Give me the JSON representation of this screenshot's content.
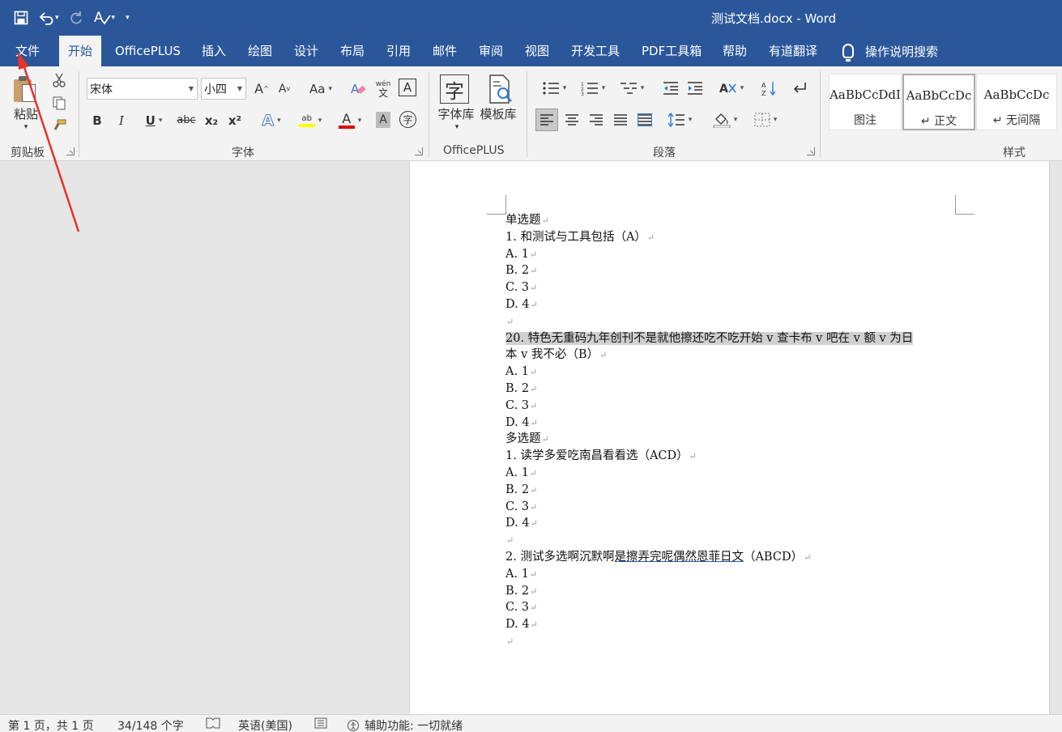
{
  "window": {
    "title": "测试文档.docx  -  Word"
  },
  "qat": {
    "icons": [
      "save-icon",
      "undo-icon",
      "redo-icon",
      "spelling-icon",
      "customize-icon"
    ]
  },
  "tabs": [
    {
      "label": "文件"
    },
    {
      "label": "开始"
    },
    {
      "label": "OfficePLUS"
    },
    {
      "label": "插入"
    },
    {
      "label": "绘图"
    },
    {
      "label": "设计"
    },
    {
      "label": "布局"
    },
    {
      "label": "引用"
    },
    {
      "label": "邮件"
    },
    {
      "label": "审阅"
    },
    {
      "label": "视图"
    },
    {
      "label": "开发工具"
    },
    {
      "label": "PDF工具箱"
    },
    {
      "label": "帮助"
    },
    {
      "label": "有道翻译"
    }
  ],
  "tell_me": "操作说明搜索",
  "ribbon": {
    "clipboard": {
      "paste_label": "粘贴",
      "group_label": "剪贴板"
    },
    "font": {
      "font_name": "宋体",
      "font_size": "小四",
      "group_label": "字体",
      "bold": "B",
      "italic": "I",
      "underline": "U",
      "strike": "abc",
      "subscript": "x₂",
      "superscript": "x²",
      "grow": "A",
      "shrink": "A",
      "case": "Aa",
      "phonetic": "wén",
      "phonetic_sub": "文",
      "border_char": "A",
      "font_color": "A",
      "shade": "A",
      "enclose": "字"
    },
    "officeplus": {
      "font_lib_icon": "字",
      "font_lib_label": "字体库",
      "template_label": "模板库",
      "group_label": "OfficePLUS"
    },
    "paragraph": {
      "group_label": "段落"
    },
    "styles": {
      "group_label": "样式",
      "items": [
        {
          "sample": "AaBbCcDdI",
          "name": "图注"
        },
        {
          "sample": "AaBbCcDc",
          "name": "↵ 正文"
        },
        {
          "sample": "AaBbCcDc",
          "name": "↵ 无间隔"
        }
      ]
    }
  },
  "document": {
    "lines": [
      {
        "text": "单选题",
        "mark": "↵"
      },
      {
        "text": "1. 和测试与工具包括（A）",
        "mark": "↵"
      },
      {
        "text": "A. 1",
        "mark": "↵"
      },
      {
        "text": "B. 2",
        "mark": "↵"
      },
      {
        "text": "C. 3",
        "mark": "↵"
      },
      {
        "text": "D. 4",
        "mark": "↵"
      },
      {
        "text": "",
        "mark": "↵"
      },
      {
        "text": "20. 特色无重码九年创刊不是就他擦还吃不吃开始 v 查卡布 v 吧在 v 额 v 为日",
        "mark": "",
        "highlight": true
      },
      {
        "text": "本 v 我不必（B）",
        "mark": "↵"
      },
      {
        "text": "A. 1",
        "mark": "↵"
      },
      {
        "text": "B. 2",
        "mark": "↵"
      },
      {
        "text": "C. 3",
        "mark": "↵"
      },
      {
        "text": "D. 4",
        "mark": "↵"
      },
      {
        "text": "多选题",
        "mark": "↵"
      },
      {
        "text": "1. 读学多爱吃南昌看看选（ACD）",
        "mark": "↵"
      },
      {
        "text": "A. 1",
        "mark": "↵"
      },
      {
        "text": "B. 2",
        "mark": "↵"
      },
      {
        "text": "C. 3",
        "mark": "↵"
      },
      {
        "text": "D. 4",
        "mark": "↵"
      },
      {
        "text": "",
        "mark": "↵"
      },
      {
        "text_pre": "2. 测试多选啊沉默啊",
        "text_ul": "是擦弄完呢偶然恩菲日文",
        "text_post": "（ABCD）",
        "mark": "↵"
      },
      {
        "text": "A. 1",
        "mark": "↵"
      },
      {
        "text": "B. 2",
        "mark": "↵"
      },
      {
        "text": "C. 3",
        "mark": "↵"
      },
      {
        "text": "D. 4",
        "mark": "↵"
      },
      {
        "text": "",
        "mark": "↵"
      }
    ]
  },
  "status": {
    "page": "第 1 页，共 1 页",
    "words": "34/148 个字",
    "language": "英语(美国)",
    "accessibility": "辅助功能: 一切就绪"
  },
  "colors": {
    "titlebar": "#2b579a",
    "ribbon": "#f3f3f3",
    "highlight": "#d0d0d0",
    "font_color_bar": "#e00000",
    "highlight_bar": "#ffff00",
    "annotation_arrow": "#e8312a"
  }
}
